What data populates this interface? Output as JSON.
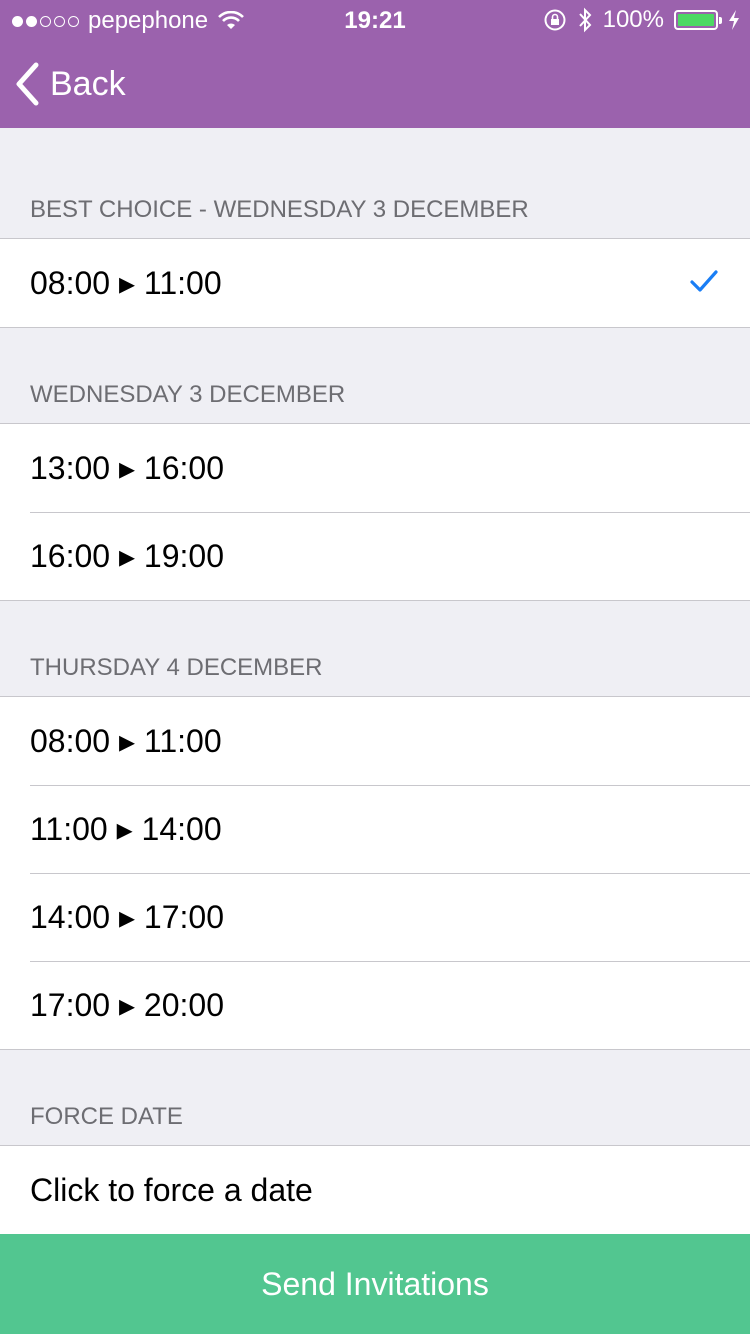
{
  "status_bar": {
    "carrier": "pepephone",
    "time": "19:21",
    "battery": "100%",
    "battery_level": 1.0,
    "signal_bars_filled": 2,
    "signal_bars_total": 5
  },
  "nav": {
    "back_label": "Back"
  },
  "sections": [
    {
      "header": "BEST CHOICE - WEDNESDAY 3 DECEMBER",
      "rows": [
        {
          "label": "08:00 ▸ 11:00",
          "checked": true
        }
      ]
    },
    {
      "header": "WEDNESDAY 3 DECEMBER",
      "rows": [
        {
          "label": "13:00 ▸ 16:00"
        },
        {
          "label": "16:00 ▸ 19:00"
        }
      ]
    },
    {
      "header": "THURSDAY 4 DECEMBER",
      "rows": [
        {
          "label": "08:00 ▸ 11:00"
        },
        {
          "label": "11:00 ▸ 14:00"
        },
        {
          "label": "14:00 ▸ 17:00"
        },
        {
          "label": "17:00 ▸ 20:00"
        }
      ]
    },
    {
      "header": "FORCE DATE",
      "rows": [
        {
          "label": "Click to force a date"
        }
      ]
    }
  ],
  "send_button": {
    "label": "Send Invitations"
  },
  "colors": {
    "nav": "#9b62ad",
    "accent_check": "#1a7ef5",
    "send_button": "#52c690",
    "battery_fill": "#4cd964"
  },
  "icons": [
    "wifi-icon",
    "lock-rotation-icon",
    "bluetooth-icon",
    "battery-icon",
    "charging-icon",
    "chevron-left-icon",
    "checkmark-icon"
  ]
}
